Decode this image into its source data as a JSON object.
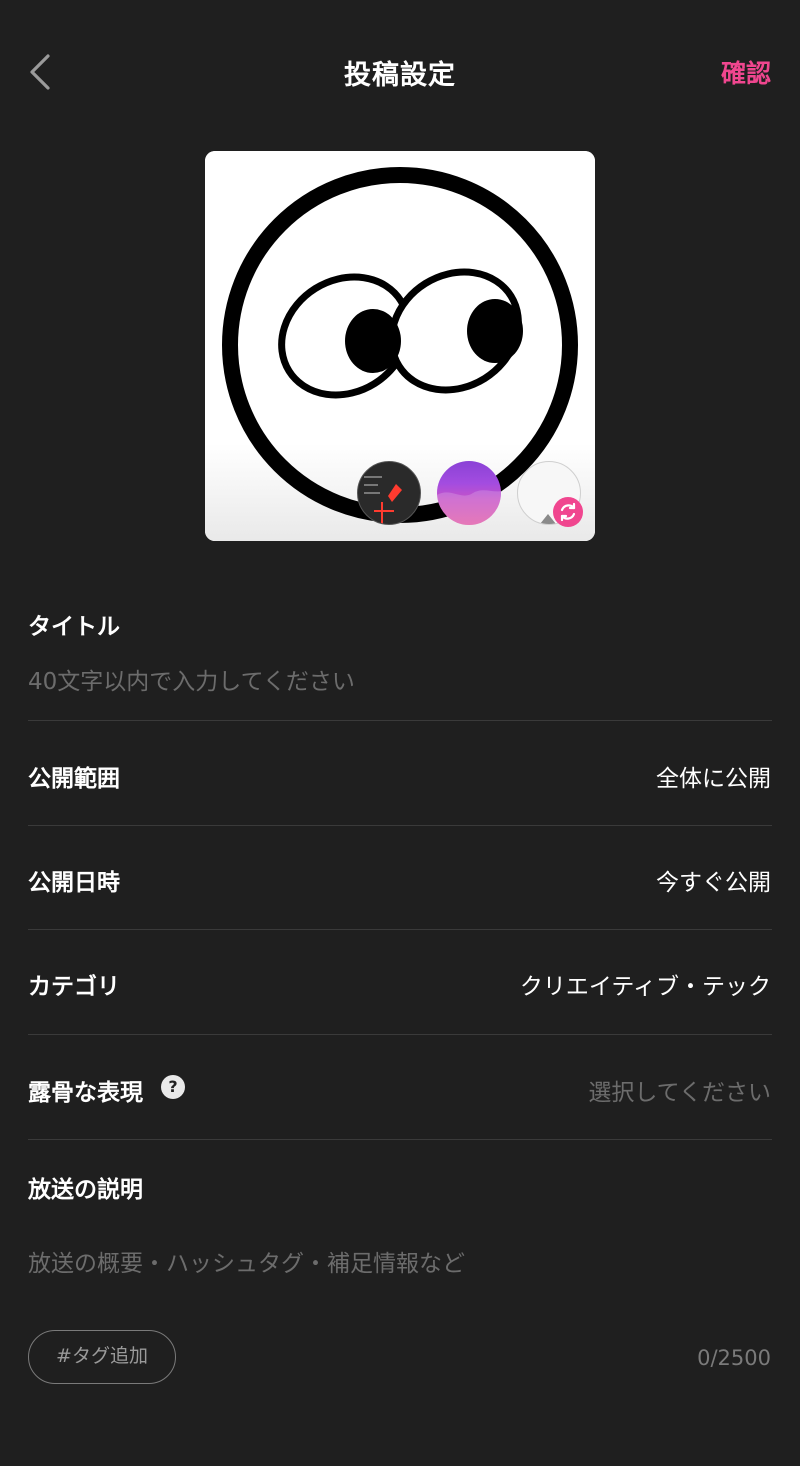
{
  "header": {
    "title": "投稿設定",
    "confirm_label": "確認",
    "back_icon": "chevron-left-icon",
    "accent_color": "#f0468f"
  },
  "thumbnail": {
    "options_icons": [
      "screenshot-thumb-icon",
      "gradient-thumb-icon",
      "blank-thumb-icon"
    ],
    "refresh_icon": "refresh-icon"
  },
  "form": {
    "title": {
      "label": "タイトル",
      "placeholder": "40文字以内で入力してください",
      "value": ""
    },
    "visibility": {
      "label": "公開範囲",
      "value": "全体に公開"
    },
    "publish_time": {
      "label": "公開日時",
      "value": "今すぐ公開"
    },
    "category": {
      "label": "カテゴリ",
      "value": "クリエイティブ・テック"
    },
    "explicit": {
      "label": "露骨な表現",
      "help_glyph": "?",
      "placeholder": "選択してください"
    },
    "description": {
      "label": "放送の説明",
      "placeholder": "放送の概要・ハッシュタグ・補足情報など",
      "value": ""
    }
  },
  "footer": {
    "tag_button_label": "#タグ追加",
    "char_counter": "0/2500"
  }
}
